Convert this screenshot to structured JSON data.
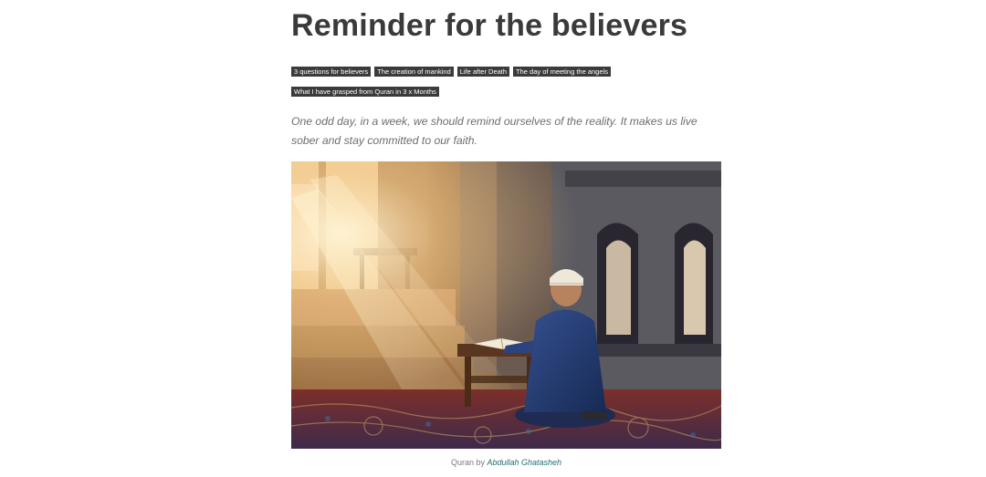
{
  "post": {
    "title": "Reminder for the believers",
    "tags_row1": [
      "3 questions for believers",
      "The creation of mankind",
      "Life after Death",
      "The day of meeting the angels"
    ],
    "tags_row2": [
      "What I have grasped from Quran in 3 x Months"
    ],
    "excerpt": "One odd day, in a week, we should remind ourselves of the reality. It makes us live sober and stay committed to our faith.",
    "image_alt": "Quran by Abdullah Ghatasheh",
    "caption": {
      "prefix": "Quran by",
      "author": "Abdullah Ghatasheh"
    }
  }
}
